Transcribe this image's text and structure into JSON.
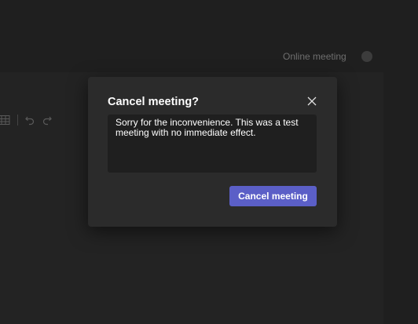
{
  "background": {
    "online_meeting_label": "Online meeting"
  },
  "dialog": {
    "title": "Cancel meeting?",
    "message": "Sorry for the inconvenience. This was a test meeting with no immediate effect.",
    "confirm_label": "Cancel meeting",
    "close_icon": "close-icon"
  },
  "colors": {
    "accent": "#5b5fc7",
    "dialog_bg": "#2b2b2b",
    "page_bg": "#1f1f1f"
  }
}
